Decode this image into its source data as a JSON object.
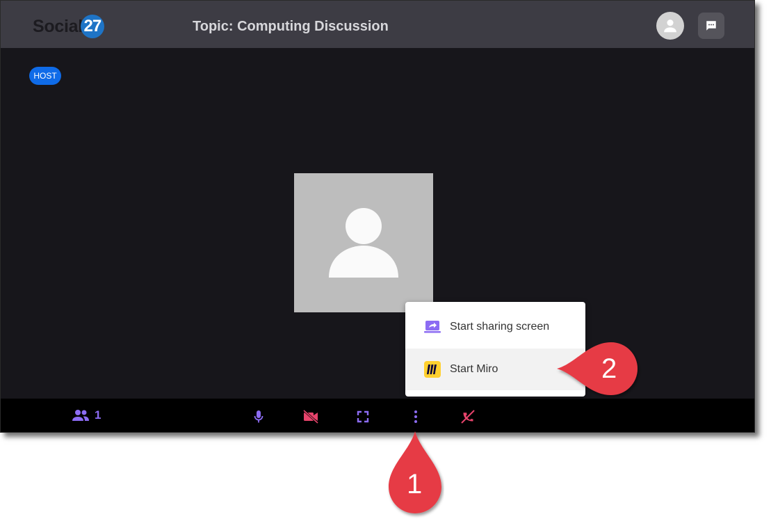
{
  "header": {
    "logo_text": "Social",
    "logo_number": "27",
    "topic_title": "Topic: Computing Discussion"
  },
  "stage": {
    "host_badge": "HOST"
  },
  "options_menu": {
    "items": [
      {
        "label": "Start sharing screen",
        "icon": "screen-share-icon"
      },
      {
        "label": "Start Miro",
        "icon": "miro-icon"
      }
    ]
  },
  "controls": {
    "participant_count": "1",
    "buttons": [
      "participants-icon",
      "microphone-icon",
      "camera-off-icon",
      "fullscreen-icon",
      "more-vertical-icon",
      "end-call-icon"
    ]
  },
  "callouts": {
    "step1": "1",
    "step2": "2"
  },
  "colors": {
    "accent_purple": "#8c6cf3",
    "danger_pink": "#e8446c",
    "host_blue": "#0f6be8",
    "callout_red": "#e63a45",
    "miro_yellow": "#ffd02f"
  }
}
